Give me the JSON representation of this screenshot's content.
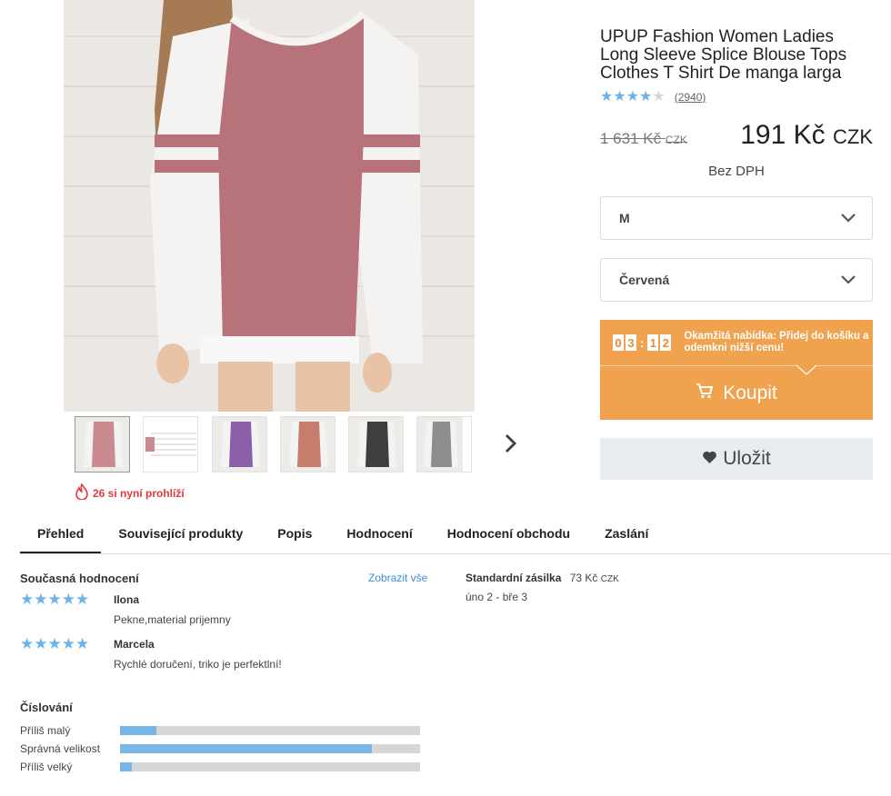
{
  "product": {
    "title": "UPUP Fashion Women Ladies Long Sleeve Splice Blouse Tops Clothes T Shirt De manga larga",
    "rating_stars": 4,
    "review_count": "(2940)",
    "old_price": "1 631 Kč",
    "old_currency": "CZK",
    "price": "191 Kč",
    "currency": "CZK",
    "tax_note": "Bez DPH"
  },
  "selects": {
    "size": "M",
    "color": "Červená"
  },
  "deal": {
    "timer": [
      "0",
      "3",
      "1",
      "2"
    ],
    "text": "Okamžitá nabídka: Přidej do košíku a odemkni nižší cenu!"
  },
  "buttons": {
    "buy": "Koupit",
    "save": "Uložit"
  },
  "viewers": "26 si nyní prohlíží",
  "tabs": [
    "Přehled",
    "Související produkty",
    "Popis",
    "Hodnocení",
    "Hodnocení obchodu",
    "Zaslání"
  ],
  "reviews": {
    "heading": "Současná hodnocení",
    "show_all": "Zobrazit vše",
    "items": [
      {
        "name": "Ilona",
        "text": "Pekne,material prijemny",
        "stars": 5
      },
      {
        "name": "Marcela",
        "text": "Rychlé doručení, triko je perfektlní!",
        "stars": 5
      }
    ]
  },
  "shipping": {
    "label": "Standardní zásilka",
    "cost": "73 Kč",
    "cost_currency": "CZK",
    "dates": "úno 2 - bře 3"
  },
  "sizing": {
    "heading": "Číslování",
    "rows": [
      {
        "label": "Příliš malý",
        "fraction": 0.12
      },
      {
        "label": "Správná velikost",
        "fraction": 0.84
      },
      {
        "label": "Příliš velký",
        "fraction": 0.04
      }
    ]
  },
  "colors": {
    "accent": "#f0a24f",
    "star": "#6db3ea",
    "viewers": "#e4393c",
    "shirt_body": "#b7727a",
    "thumb_colors": [
      "#c98b8f",
      "#ffffff",
      "#8a5fa8",
      "#c57e6c",
      "#3e3e3e",
      "#8d8d8d"
    ]
  }
}
